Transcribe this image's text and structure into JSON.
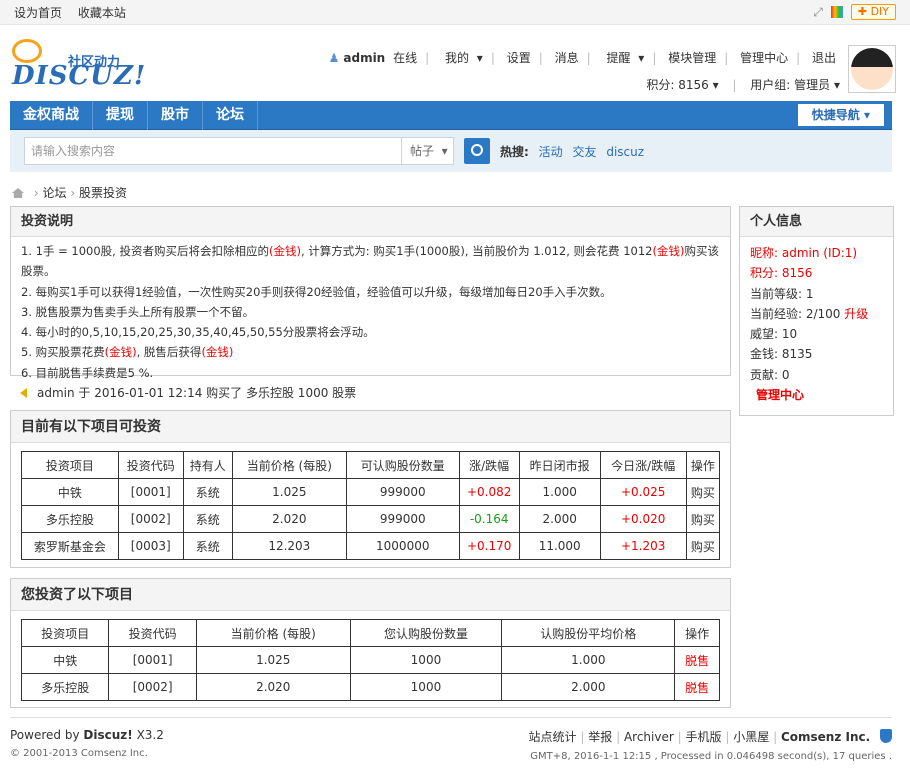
{
  "topbar": {
    "set_home": "设为首页",
    "bookmark": "收藏本站",
    "diy": "DIY"
  },
  "logo": {
    "brand": "DISCUZ!",
    "tagline": "社区动力"
  },
  "user": {
    "name": "admin",
    "online": "在线",
    "my": "我的",
    "settings": "设置",
    "messages": "消息",
    "remind": "提醒",
    "module": "模块管理",
    "admin_center": "管理中心",
    "logout": "退出",
    "points_label": "积分: 8156",
    "group": "用户组: 管理员"
  },
  "nav": {
    "items": [
      "金权商战",
      "提现",
      "股市",
      "论坛"
    ],
    "quick": "快捷导航"
  },
  "search": {
    "placeholder": "请输入搜索内容",
    "type": "帖子",
    "hot_label": "热搜:",
    "hot": [
      "活动",
      "交友",
      "discuz"
    ]
  },
  "breadcrumb": {
    "forum": "论坛",
    "current": "股票投资"
  },
  "instructions": {
    "title": "投资说明",
    "lines": [
      [
        "1. 1手 = 1000股, 投资者购买后将会扣除相应的",
        "(金钱)",
        ", 计算方式为: 购买1手(1000股), 当前股价为 1.012, 则会花费 1012",
        "(金钱)",
        "购买该股票。"
      ],
      [
        "2. 每购买1手可以获得1经验值，一次性购买20手则获得20经验值，经验值可以升级，每级增加每日20手入手次数。"
      ],
      [
        "3. 脱售股票为售卖手头上所有股票一个不留。"
      ],
      [
        "4. 每小时的0,5,10,15,20,25,30,35,40,45,50,55分股票将会浮动。"
      ],
      [
        "5. 购买股票花费",
        "(金钱)",
        ", 脱售后获得",
        "(金钱)"
      ],
      [
        "6. 目前脱售手续费是5 %."
      ]
    ]
  },
  "notice": "admin 于 2016-01-01 12:14 购买了 多乐控股 1000 股票",
  "projects": {
    "title": "目前有以下项目可投资",
    "headers": [
      "投资项目",
      "投资代码",
      "持有人",
      "当前价格 (每股)",
      "可认购股份数量",
      "涨/跌幅",
      "昨日闭市报",
      "今日涨/跌幅",
      "操作"
    ],
    "rows": [
      [
        "中铁",
        "[0001]",
        "系统",
        "1.025",
        "999000",
        "+0.082",
        "1.000",
        "+0.025",
        "购买"
      ],
      [
        "多乐控股",
        "[0002]",
        "系统",
        "2.020",
        "999000",
        "-0.164",
        "2.000",
        "+0.020",
        "购买"
      ],
      [
        "索罗斯基金会",
        "[0003]",
        "系统",
        "12.203",
        "1000000",
        "+0.170",
        "11.000",
        "+1.203",
        "购买"
      ]
    ]
  },
  "holdings": {
    "title": "您投资了以下项目",
    "headers": [
      "投资项目",
      "投资代码",
      "当前价格 (每股)",
      "您认购股份数量",
      "认购股份平均价格",
      "操作"
    ],
    "rows": [
      [
        "中铁",
        "[0001]",
        "1.025",
        "1000",
        "1.000",
        "脱售"
      ],
      [
        "多乐控股",
        "[0002]",
        "2.020",
        "1000",
        "2.000",
        "脱售"
      ]
    ]
  },
  "profile": {
    "title": "个人信息",
    "nickname": "昵称: admin (ID:1)",
    "points": "积分: 8156",
    "level": "当前等级: 1",
    "exp": "当前经验: 2/100",
    "upgrade": "升级",
    "prestige": "威望: 10",
    "money": "金钱: 8135",
    "contrib": "贡献: 0",
    "admin_link": "管理中心"
  },
  "footer": {
    "powered": "Powered by",
    "product": "Discuz!",
    "version": "X3.2",
    "copyright": "© 2001-2013 Comsenz Inc.",
    "links": [
      "站点统计",
      "举报",
      "Archiver",
      "手机版",
      "小黑屋"
    ],
    "company": "Comsenz Inc.",
    "gmt": "GMT+8, 2016-1-1 12:15 , Processed in 0.046498 second(s), 17 queries ."
  },
  "colors": {
    "nav": "#2b79c5",
    "accent_red": "#e00000",
    "accent_green": "#1a9f1a"
  }
}
